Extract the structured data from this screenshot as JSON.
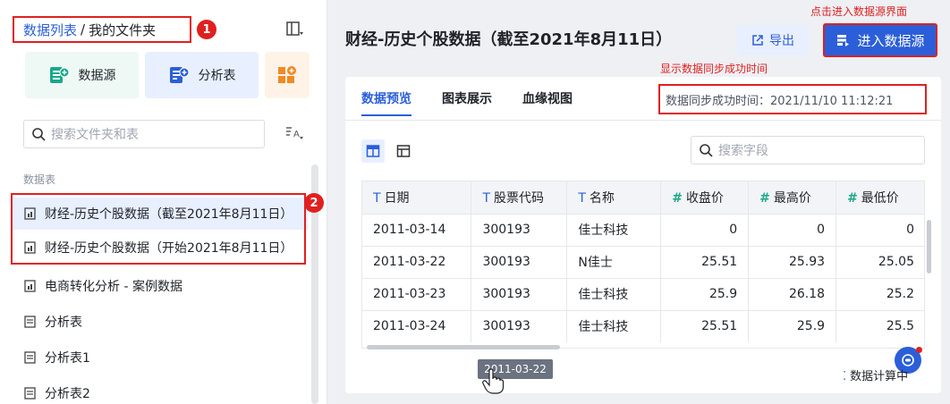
{
  "sidebar": {
    "breadcrumb": {
      "root": "数据列表",
      "separator": "/",
      "current": "我的文件夹"
    },
    "annotation_1": "1",
    "annotation_2": "2",
    "tools": {
      "datasource": "数据源",
      "analysis": "分析表"
    },
    "search_placeholder": "搜索文件夹和表",
    "section_label": "数据表",
    "items": [
      {
        "label": "财经-历史个股数据（截至2021年8月11日）",
        "icon": "dataset-icon"
      },
      {
        "label": "财经-历史个股数据（开始2021年8月11日）",
        "icon": "dataset-icon"
      },
      {
        "label": "电商转化分析 - 案例数据",
        "icon": "dataset-icon"
      },
      {
        "label": "分析表",
        "icon": "sheet-icon"
      },
      {
        "label": "分析表1",
        "icon": "sheet-icon"
      },
      {
        "label": "分析表2",
        "icon": "sheet-icon"
      }
    ]
  },
  "main": {
    "title": "财经-历史个股数据（截至2021年8月11日）",
    "export_label": "导出",
    "enter_label": "进入数据源",
    "annotation_enter": "点击进入数据源界面",
    "annotation_sync": "显示数据同步成功时间",
    "tabs": [
      "数据预览",
      "图表展示",
      "血缘视图"
    ],
    "sync_text": "数据同步成功时间：2021/11/10 11:12:21",
    "field_search_placeholder": "搜索字段",
    "table": {
      "columns": [
        {
          "label": "日期",
          "type": "T"
        },
        {
          "label": "股票代码",
          "type": "T"
        },
        {
          "label": "名称",
          "type": "T"
        },
        {
          "label": "收盘价",
          "type": "#"
        },
        {
          "label": "最高价",
          "type": "#"
        },
        {
          "label": "最低价",
          "type": "#"
        }
      ],
      "rows": [
        [
          "2011-03-14",
          "300193",
          "佳士科技",
          "0",
          "0",
          "0"
        ],
        [
          "2011-03-22",
          "300193",
          "N佳士",
          "25.51",
          "25.93",
          "25.05"
        ],
        [
          "2011-03-23",
          "300193",
          "佳士科技",
          "25.9",
          "26.18",
          "25.2"
        ],
        [
          "2011-03-24",
          "300193",
          "佳士科技",
          "25.51",
          "25.9",
          "25.5"
        ]
      ]
    },
    "tooltip_text": "2011-03-22",
    "calc_status": "数据计算中"
  },
  "colors": {
    "accent": "#2b5fd9",
    "annotation": "#e02020",
    "number_type": "#1aa88a"
  }
}
